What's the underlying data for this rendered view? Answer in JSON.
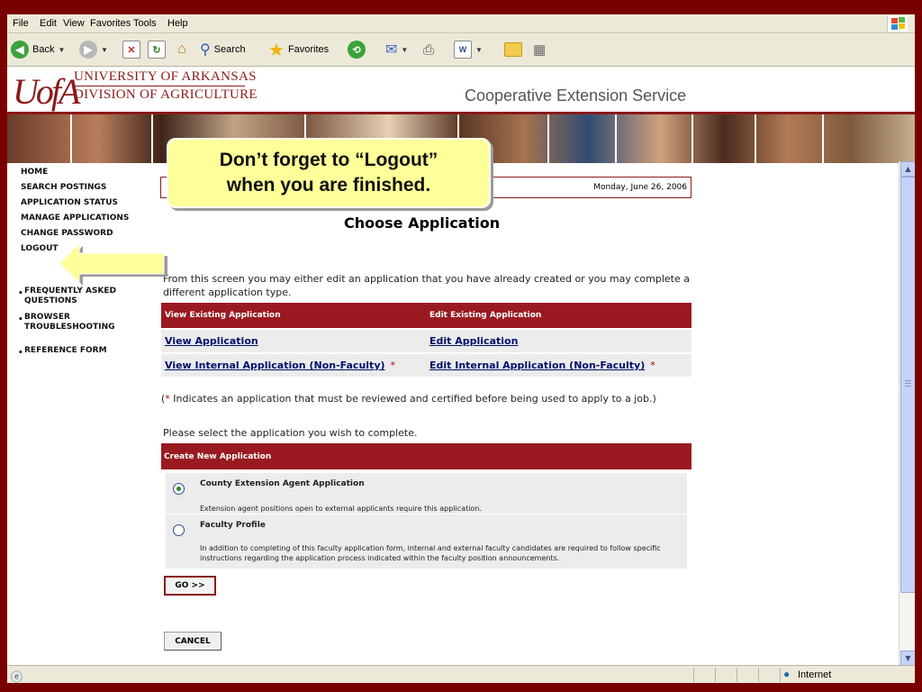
{
  "menu": [
    "File",
    "Edit",
    "View",
    "Favorites",
    "Tools",
    "Help"
  ],
  "toolbar": {
    "back": "Back",
    "search": "Search",
    "favorites": "Favorites"
  },
  "header": {
    "logo": "UofA",
    "univ_line1": "UNIVERSITY OF ARKANSAS",
    "univ_line2": "DIVISION OF AGRICULTURE",
    "service": "Cooperative Extension Service"
  },
  "callout": {
    "line1": "Don’t forget to “Logout”",
    "line2": "when you are finished."
  },
  "nav": {
    "items": [
      "HOME",
      "SEARCH POSTINGS",
      "APPLICATION STATUS",
      "MANAGE APPLICATIONS",
      "CHANGE PASSWORD",
      "LOGOUT"
    ],
    "links": [
      "FREQUENTLY ASKED QUESTIONS",
      "BROWSER TROUBLESHOOTING",
      "REFERENCE FORM"
    ]
  },
  "date": "Monday, June 26, 2006",
  "page_title": "Choose Application",
  "intro": "From this screen you may either edit an application that you have already created or you may complete a different application type.",
  "existing": {
    "col_view": "View Existing Application",
    "col_edit": "Edit Existing Application",
    "rows": [
      {
        "view": "View Application",
        "edit": "Edit Application",
        "star": ""
      },
      {
        "view": "View Internal Application (Non-Faculty)",
        "edit": "Edit Internal Application (Non-Faculty)",
        "star": "*"
      }
    ]
  },
  "note": {
    "star": "*",
    "text": " Indicates an application that must be reviewed and certified before being used to apply to a job.)",
    "open": "("
  },
  "please": "Please select the application you wish to complete.",
  "create_header": "Create New Application",
  "options": [
    {
      "title": "County Extension Agent Application",
      "desc": "Extension agent positions open to external applicants require this application.",
      "selected": true
    },
    {
      "title": "Faculty Profile",
      "desc": "In addition to completing of this faculty application form, internal and external faculty candidates are required to follow specific instructions regarding the application process indicated within the faculty position announcements.",
      "selected": false
    }
  ],
  "go_label": "GO >>",
  "cancel_label": "CANCEL",
  "status_zone": "Internet",
  "colors": {
    "frame": "#7a0000",
    "accent": "#9b1a22",
    "callout": "#ffff99",
    "link": "#00116a"
  }
}
